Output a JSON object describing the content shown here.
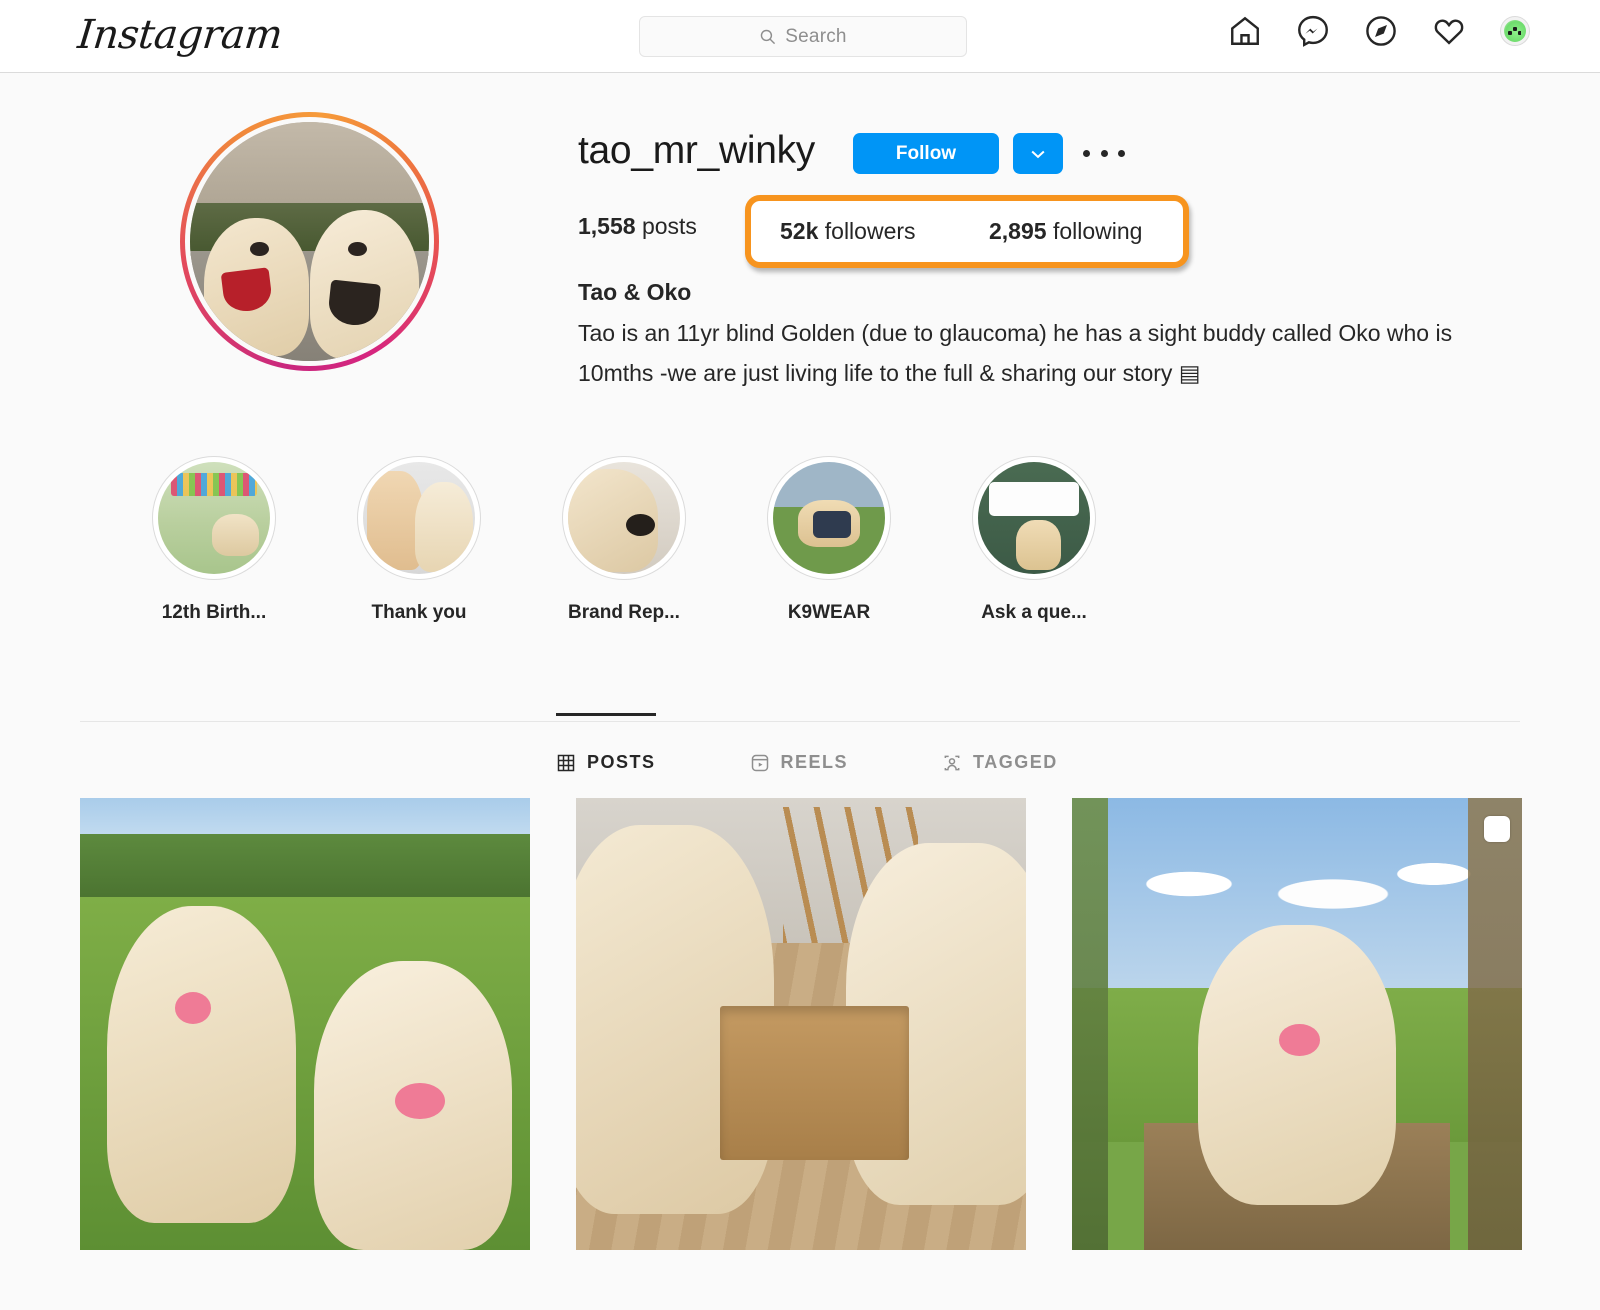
{
  "header": {
    "logo_text": "Instagram",
    "search": {
      "placeholder": "Search",
      "value": ""
    },
    "nav": [
      {
        "name": "home-icon",
        "label": "Home"
      },
      {
        "name": "messenger-icon",
        "label": "Messenger"
      },
      {
        "name": "compass-icon",
        "label": "Explore"
      },
      {
        "name": "heart-icon",
        "label": "Activity"
      },
      {
        "name": "avatar",
        "label": "Profile"
      }
    ]
  },
  "profile": {
    "username": "tao_mr_winky",
    "follow_label": "Follow",
    "chevron_icon": "chevron-down-icon",
    "more_icon": "more-options-icon",
    "stats": {
      "posts_value": "1,558",
      "posts_label": "posts",
      "followers_value": "52k",
      "followers_label": "followers",
      "following_value": "2,895",
      "following_label": "following"
    },
    "highlight_color": "#f7941e",
    "bio_name": "Tao & Oko",
    "bio_text": "Tao is an 11yr blind Golden (due to glaucoma) he has a sight buddy called Oko who is 10mths -we are just living life to the full & sharing our story ",
    "bio_glyph": "▤"
  },
  "highlights": [
    {
      "label": "12th Birth...",
      "thumb": "t1"
    },
    {
      "label": "Thank you",
      "thumb": "t2"
    },
    {
      "label": "Brand Rep...",
      "thumb": "t3"
    },
    {
      "label": "K9WEAR",
      "thumb": "t4"
    },
    {
      "label": "Ask a que...",
      "thumb": "t5"
    }
  ],
  "tabs": [
    {
      "label": "POSTS",
      "icon": "grid-icon",
      "active": true
    },
    {
      "label": "REELS",
      "icon": "reels-icon",
      "active": false
    },
    {
      "label": "TAGGED",
      "icon": "tagged-icon",
      "active": false
    }
  ],
  "posts": [
    {
      "alt": "Two golden retrievers sitting in a green field",
      "multi": false
    },
    {
      "alt": "Two golden retrievers inspecting a cardboard box on a wood floor",
      "multi": false
    },
    {
      "alt": "Golden retriever walking along a dirt path under a blue sky",
      "multi": true
    }
  ],
  "colors": {
    "accent_blue": "#0095f6",
    "highlight_orange": "#f7941e",
    "background": "#fafafa",
    "text": "#262626",
    "muted": "#8e8e8e"
  }
}
